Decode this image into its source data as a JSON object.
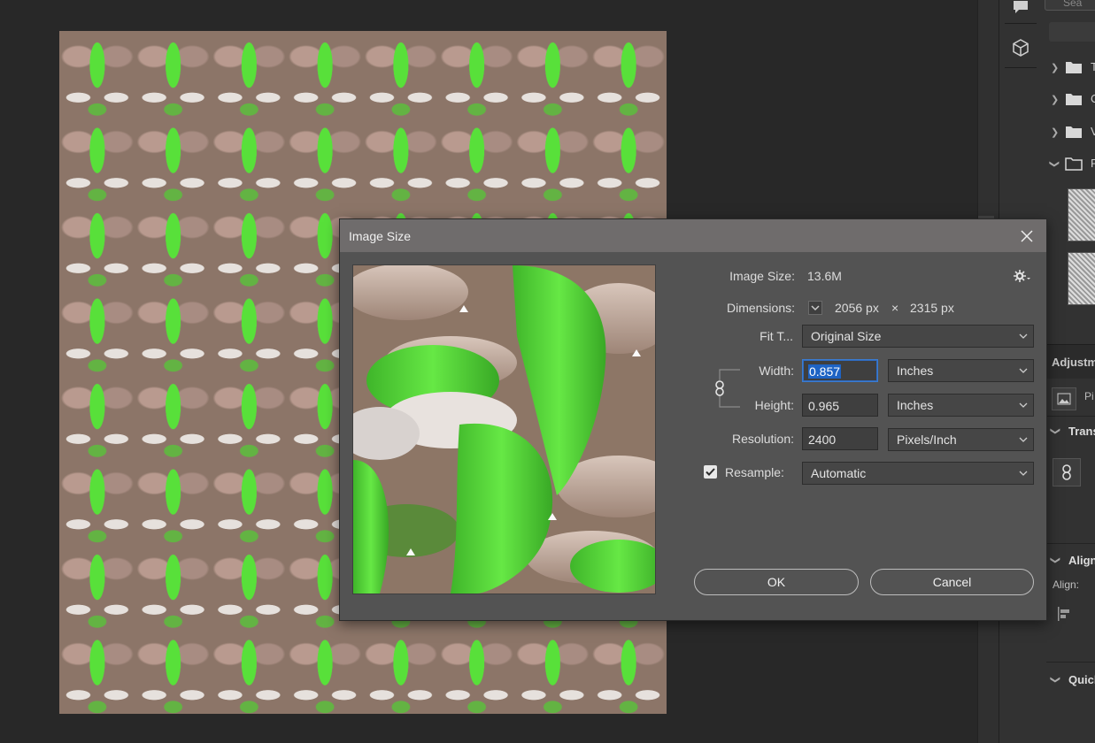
{
  "dialog": {
    "title": "Image Size",
    "image_size_label": "Image Size:",
    "image_size_value": "13.6M",
    "dimensions_label": "Dimensions:",
    "dimensions_width": "2056 px",
    "dimensions_times": "×",
    "dimensions_height": "2315 px",
    "fit_to_label": "Fit T...",
    "fit_to_value": "Original Size",
    "width_label": "Width:",
    "width_value": "0.857",
    "width_unit": "Inches",
    "height_label": "Height:",
    "height_value": "0.965",
    "height_unit": "Inches",
    "resolution_label": "Resolution:",
    "resolution_value": "2400",
    "resolution_unit": "Pixels/Inch",
    "resample_label": "Resample:",
    "resample_checked": true,
    "resample_value": "Automatic",
    "ok_label": "OK",
    "cancel_label": "Cancel"
  },
  "right_panel": {
    "search_placeholder": "Sea",
    "folders": [
      {
        "label": "T"
      },
      {
        "label": "C"
      },
      {
        "label": "V"
      },
      {
        "label": "F"
      }
    ],
    "adjustments_header": "Adjustm",
    "adjust_item": "Pi",
    "transform_section": "Trans",
    "align_section": "Align",
    "align_label": "Align:",
    "quick_section": "Quick"
  },
  "colors": {
    "dialog_bg": "#535353",
    "titlebar_bg": "#6f6c6c",
    "app_bg": "#282828",
    "selection": "#1e63c4",
    "yarn_green": "#58e03a"
  },
  "icons": [
    "comment-icon",
    "cube-icon",
    "gear-icon",
    "chain-link-icon",
    "close-icon",
    "chevron-down-icon",
    "folder-icon",
    "image-icon"
  ]
}
